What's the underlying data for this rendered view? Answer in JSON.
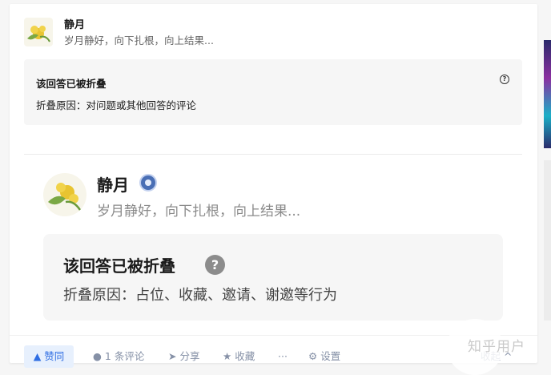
{
  "top_answer": {
    "author_name": "静月",
    "author_bio": "岁月静好，向下扎根，向上结果...",
    "fold_title": "该回答已被折叠",
    "fold_reason": "折叠原因：对问题或其他回答的评论",
    "help_glyph": "?"
  },
  "zoom_answer": {
    "author_name": "静月",
    "author_bio": "岁月静好，向下扎根，向上结果...",
    "badge_icon": "badge-icon",
    "fold_title": "该回答已被折叠",
    "fold_reason": "折叠原因：占位、收藏、邀请、谢邀等行为",
    "help_glyph": "?"
  },
  "actions": {
    "vote_label": "▲ 赞同",
    "comment_label": "1 条评论",
    "share_label": "分享",
    "favorite_label": "收藏",
    "more_label": "···",
    "settings_label": "设置",
    "collapse_label": "收起 ^"
  },
  "watermark": "知乎用户",
  "colors": {
    "accent": "#2f6ee3",
    "vote_bg": "#e7f0fd",
    "fold_bg": "#f6f6f6"
  }
}
